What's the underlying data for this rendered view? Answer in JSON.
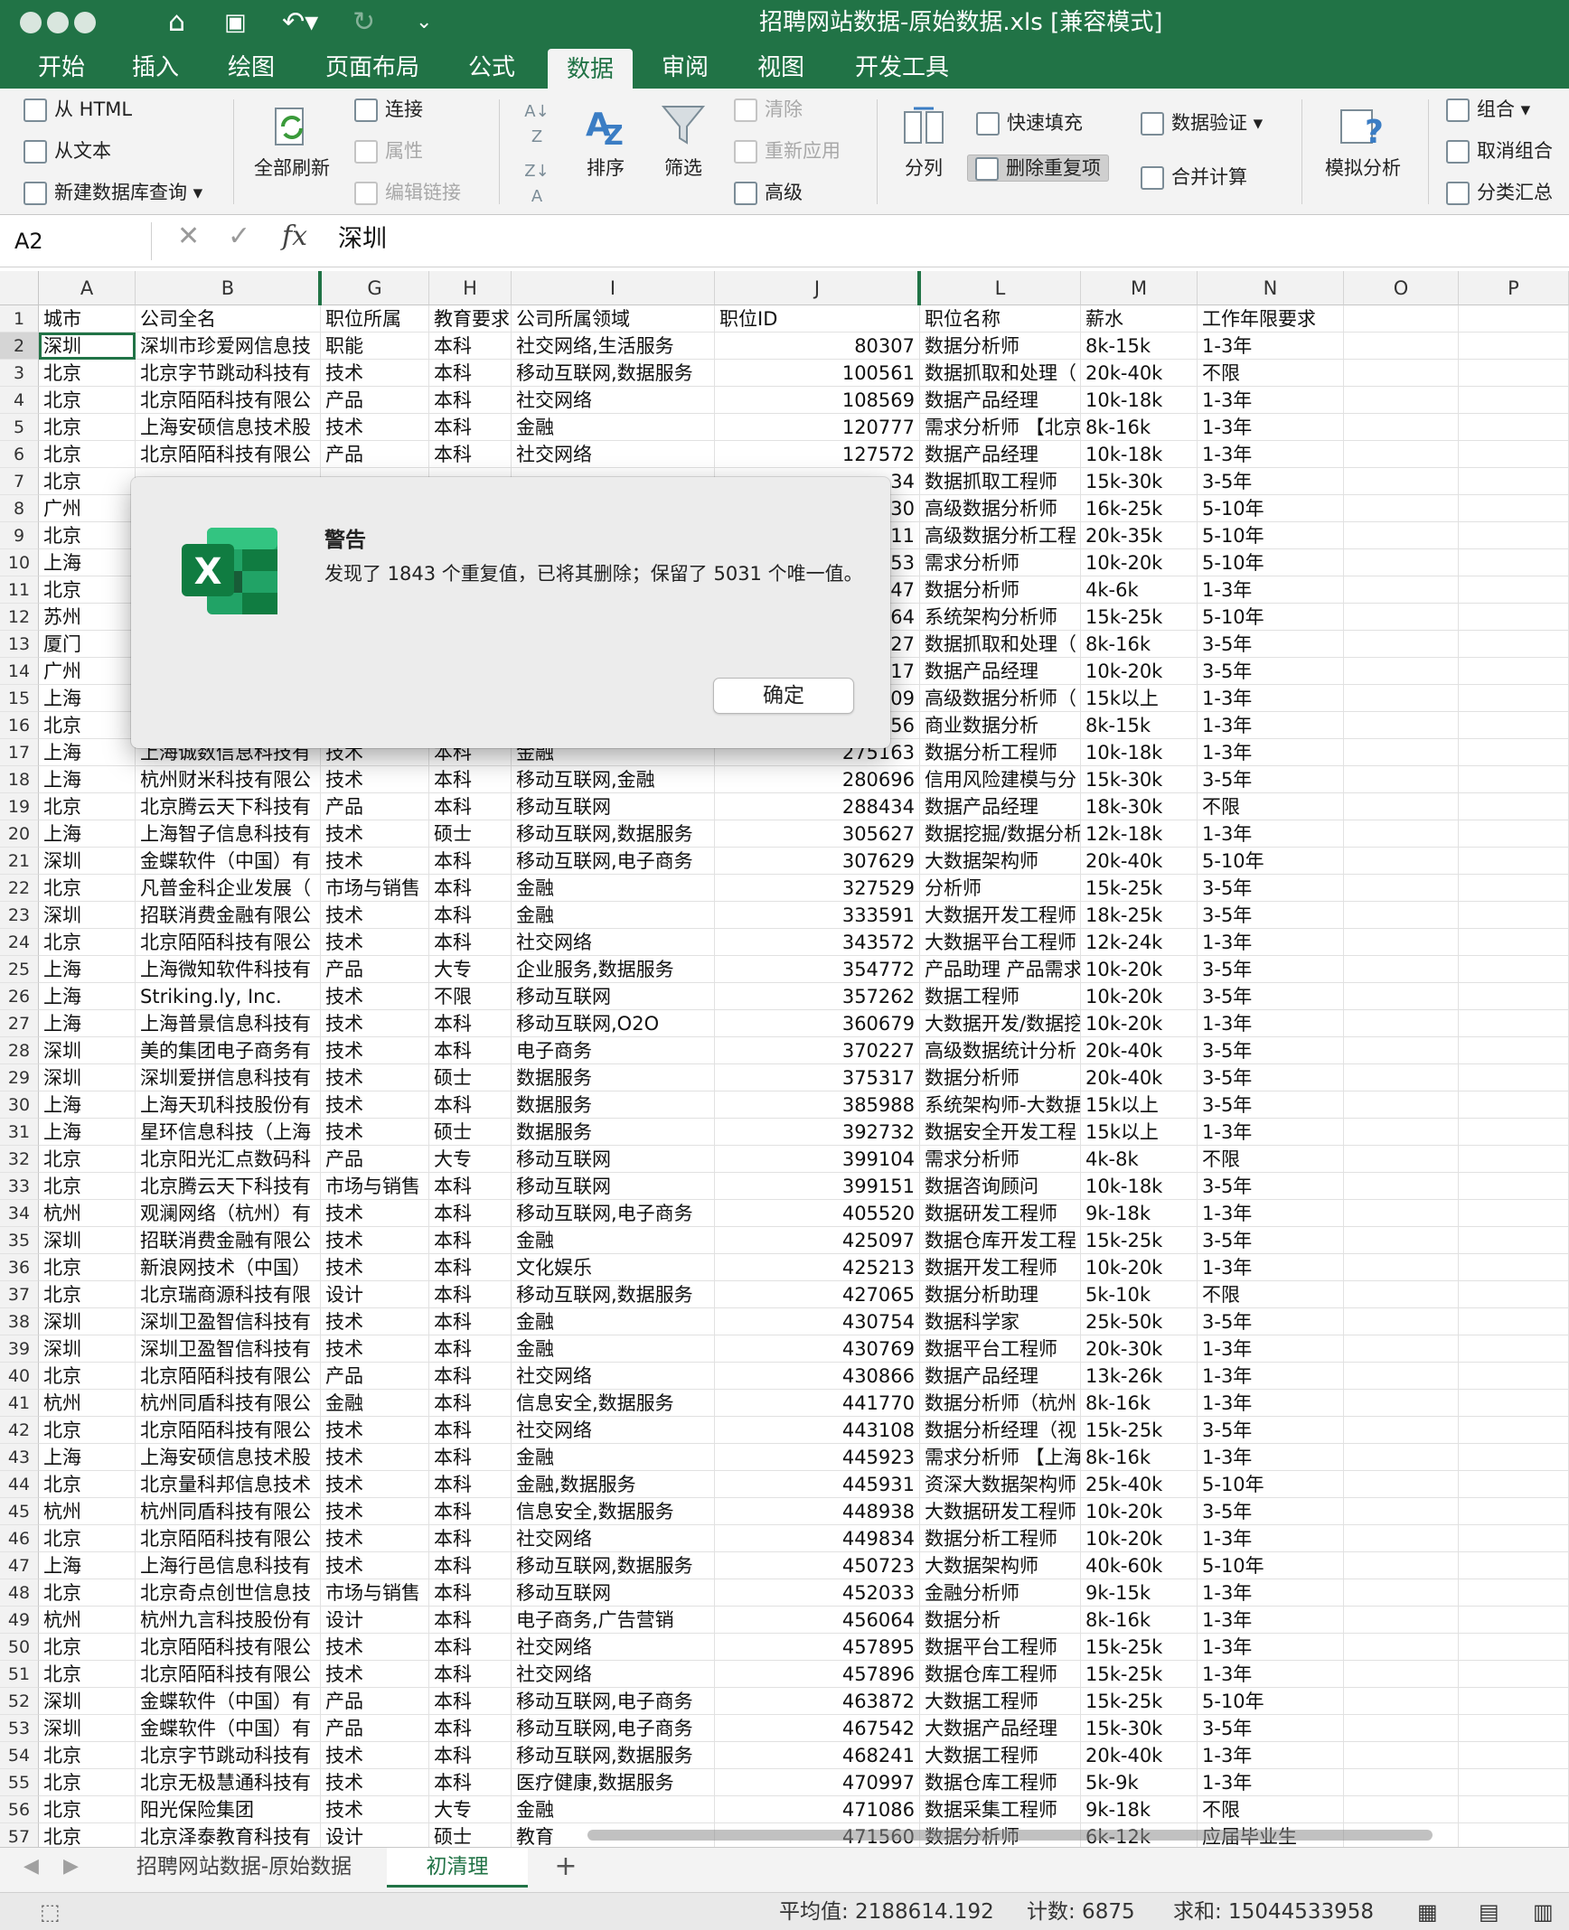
{
  "window": {
    "title": "招聘网站数据-原始数据.xls  [兼容模式]"
  },
  "ribbon_tabs": [
    {
      "label": "开始",
      "active": false
    },
    {
      "label": "插入",
      "active": false
    },
    {
      "label": "绘图",
      "active": false
    },
    {
      "label": "页面布局",
      "active": false
    },
    {
      "label": "公式",
      "active": false
    },
    {
      "label": "数据",
      "active": true
    },
    {
      "label": "审阅",
      "active": false
    },
    {
      "label": "视图",
      "active": false
    },
    {
      "label": "开发工具",
      "active": false
    }
  ],
  "ribbon": {
    "from_html": "从 HTML",
    "from_text": "从文本",
    "new_db_query": "新建数据库查询",
    "refresh_all": "全部刷新",
    "connections": "连接",
    "properties": "属性",
    "edit_links": "编辑链接",
    "sort": "排序",
    "filter": "筛选",
    "clear": "清除",
    "reapply": "重新应用",
    "advanced": "高级",
    "text_to_columns": "分列",
    "flash_fill": "快速填充",
    "remove_duplicates": "删除重复项",
    "data_validation": "数据验证",
    "consolidate": "合并计算",
    "what_if": "模拟分析",
    "group": "组合",
    "ungroup": "取消组合",
    "subtotal": "分类汇总"
  },
  "formula_bar": {
    "name_box": "A2",
    "fx": "fx",
    "value": "深圳"
  },
  "columns": [
    "A",
    "B",
    "G",
    "H",
    "I",
    "J",
    "L",
    "M",
    "N",
    "O",
    "P"
  ],
  "rows": [
    {
      "n": "1",
      "c": [
        "城市",
        "公司全名",
        "职位所属",
        "教育要求",
        "公司所属领域",
        "职位ID",
        "职位名称",
        "薪水",
        "工作年限要求"
      ]
    },
    {
      "n": "2",
      "c": [
        "深圳",
        "深圳市珍爱网信息技",
        "职能",
        "本科",
        "社交网络,生活服务",
        "80307",
        "数据分析师",
        "8k-15k",
        "1-3年"
      ]
    },
    {
      "n": "3",
      "c": [
        "北京",
        "北京字节跳动科技有",
        "技术",
        "本科",
        "移动互联网,数据服务",
        "100561",
        "数据抓取和处理（",
        "20k-40k",
        "不限"
      ]
    },
    {
      "n": "4",
      "c": [
        "北京",
        "北京陌陌科技有限公",
        "产品",
        "本科",
        "社交网络",
        "108569",
        "数据产品经理",
        "10k-18k",
        "1-3年"
      ]
    },
    {
      "n": "5",
      "c": [
        "北京",
        "上海安硕信息技术股",
        "技术",
        "本科",
        "金融",
        "120777",
        "需求分析师 【北京",
        "8k-16k",
        "1-3年"
      ]
    },
    {
      "n": "6",
      "c": [
        "北京",
        "北京陌陌科技有限公",
        "产品",
        "本科",
        "社交网络",
        "127572",
        "数据产品经理",
        "10k-18k",
        "1-3年"
      ]
    },
    {
      "n": "7",
      "c": [
        "北京",
        "",
        "",
        "",
        "",
        "34",
        "数据抓取工程师",
        "15k-30k",
        "3-5年"
      ]
    },
    {
      "n": "8",
      "c": [
        "广州",
        "",
        "",
        "",
        "",
        "30",
        "高级数据分析师",
        "16k-25k",
        "5-10年"
      ]
    },
    {
      "n": "9",
      "c": [
        "北京",
        "",
        "",
        "",
        "",
        "11",
        "高级数据分析工程",
        "20k-35k",
        "5-10年"
      ]
    },
    {
      "n": "10",
      "c": [
        "上海",
        "",
        "",
        "",
        "",
        "53",
        "需求分析师",
        "10k-20k",
        "5-10年"
      ]
    },
    {
      "n": "11",
      "c": [
        "北京",
        "",
        "",
        "",
        "",
        "47",
        "数据分析师",
        "4k-6k",
        "1-3年"
      ]
    },
    {
      "n": "12",
      "c": [
        "苏州",
        "",
        "",
        "",
        "",
        "64",
        "系统架构分析师",
        "15k-25k",
        "5-10年"
      ]
    },
    {
      "n": "13",
      "c": [
        "厦门",
        "",
        "",
        "",
        "",
        "27",
        "数据抓取和处理（",
        "8k-16k",
        "3-5年"
      ]
    },
    {
      "n": "14",
      "c": [
        "广州",
        "",
        "",
        "",
        "",
        "17",
        "数据产品经理",
        "10k-20k",
        "3-5年"
      ]
    },
    {
      "n": "15",
      "c": [
        "上海",
        "",
        "",
        "",
        "",
        "09",
        "高级数据分析师（",
        "15k以上",
        "1-3年"
      ]
    },
    {
      "n": "16",
      "c": [
        "北京",
        "",
        "",
        "",
        "",
        "56",
        "商业数据分析",
        "8k-15k",
        "1-3年"
      ]
    },
    {
      "n": "17",
      "c": [
        "上海",
        "上海诚数信息科技有",
        "技术",
        "本科",
        "金融",
        "275163",
        "数据分析工程师",
        "10k-18k",
        "1-3年"
      ]
    },
    {
      "n": "18",
      "c": [
        "上海",
        "杭州财米科技有限公",
        "技术",
        "本科",
        "移动互联网,金融",
        "280696",
        "信用风险建模与分",
        "15k-30k",
        "3-5年"
      ]
    },
    {
      "n": "19",
      "c": [
        "北京",
        "北京腾云天下科技有",
        "产品",
        "本科",
        "移动互联网",
        "288434",
        "数据产品经理",
        "18k-30k",
        "不限"
      ]
    },
    {
      "n": "20",
      "c": [
        "上海",
        "上海智子信息科技有",
        "技术",
        "硕士",
        "移动互联网,数据服务",
        "305627",
        "数据挖掘/数据分析",
        "12k-18k",
        "1-3年"
      ]
    },
    {
      "n": "21",
      "c": [
        "深圳",
        "金蝶软件（中国）有",
        "技术",
        "本科",
        "移动互联网,电子商务",
        "307629",
        "大数据架构师",
        "20k-40k",
        "5-10年"
      ]
    },
    {
      "n": "22",
      "c": [
        "北京",
        "凡普金科企业发展（",
        "市场与销售",
        "本科",
        "金融",
        "327529",
        "分析师",
        "15k-25k",
        "3-5年"
      ]
    },
    {
      "n": "23",
      "c": [
        "深圳",
        "招联消费金融有限公",
        "技术",
        "本科",
        "金融",
        "333591",
        "大数据开发工程师",
        "18k-25k",
        "3-5年"
      ]
    },
    {
      "n": "24",
      "c": [
        "北京",
        "北京陌陌科技有限公",
        "技术",
        "本科",
        "社交网络",
        "343572",
        "大数据平台工程师",
        "12k-24k",
        "1-3年"
      ]
    },
    {
      "n": "25",
      "c": [
        "上海",
        "上海微知软件科技有",
        "产品",
        "大专",
        "企业服务,数据服务",
        "354772",
        "产品助理 产品需求",
        "10k-20k",
        "3-5年"
      ]
    },
    {
      "n": "26",
      "c": [
        "上海",
        "Striking.ly, Inc.",
        "技术",
        "不限",
        "移动互联网",
        "357262",
        "数据工程师",
        "10k-20k",
        "3-5年"
      ]
    },
    {
      "n": "27",
      "c": [
        "上海",
        "上海普景信息科技有",
        "技术",
        "本科",
        "移动互联网,O2O",
        "360679",
        "大数据开发/数据挖",
        "10k-20k",
        "1-3年"
      ]
    },
    {
      "n": "28",
      "c": [
        "深圳",
        "美的集团电子商务有",
        "技术",
        "本科",
        "电子商务",
        "370227",
        "高级数据统计分析",
        "20k-40k",
        "3-5年"
      ]
    },
    {
      "n": "29",
      "c": [
        "深圳",
        "深圳爱拼信息科技有",
        "技术",
        "硕士",
        "数据服务",
        "375317",
        "数据分析师",
        "20k-40k",
        "3-5年"
      ]
    },
    {
      "n": "30",
      "c": [
        "上海",
        "上海天玑科技股份有",
        "技术",
        "本科",
        "数据服务",
        "385988",
        "系统架构师-大数据",
        "15k以上",
        "3-5年"
      ]
    },
    {
      "n": "31",
      "c": [
        "上海",
        "星环信息科技（上海",
        "技术",
        "硕士",
        "数据服务",
        "392732",
        "数据安全开发工程",
        "15k以上",
        "1-3年"
      ]
    },
    {
      "n": "32",
      "c": [
        "北京",
        "北京阳光汇点数码科",
        "产品",
        "大专",
        "移动互联网",
        "399104",
        "需求分析师",
        "4k-8k",
        "不限"
      ]
    },
    {
      "n": "33",
      "c": [
        "北京",
        "北京腾云天下科技有",
        "市场与销售",
        "本科",
        "移动互联网",
        "399151",
        "数据咨询顾问",
        "10k-18k",
        "3-5年"
      ]
    },
    {
      "n": "34",
      "c": [
        "杭州",
        "观澜网络（杭州）有",
        "技术",
        "本科",
        "移动互联网,电子商务",
        "405520",
        "数据研发工程师",
        "9k-18k",
        "1-3年"
      ]
    },
    {
      "n": "35",
      "c": [
        "深圳",
        "招联消费金融有限公",
        "技术",
        "本科",
        "金融",
        "425097",
        "数据仓库开发工程",
        "15k-25k",
        "3-5年"
      ]
    },
    {
      "n": "36",
      "c": [
        "北京",
        "新浪网技术（中国）",
        "技术",
        "本科",
        "文化娱乐",
        "425213",
        "数据开发工程师",
        "10k-20k",
        "1-3年"
      ]
    },
    {
      "n": "37",
      "c": [
        "北京",
        "北京瑞商源科技有限",
        "设计",
        "本科",
        "移动互联网,数据服务",
        "427065",
        "数据分析助理",
        "5k-10k",
        "不限"
      ]
    },
    {
      "n": "38",
      "c": [
        "深圳",
        "深圳卫盈智信科技有",
        "技术",
        "本科",
        "金融",
        "430754",
        "数据科学家",
        "25k-50k",
        "3-5年"
      ]
    },
    {
      "n": "39",
      "c": [
        "深圳",
        "深圳卫盈智信科技有",
        "技术",
        "本科",
        "金融",
        "430769",
        "数据平台工程师",
        "20k-30k",
        "1-3年"
      ]
    },
    {
      "n": "40",
      "c": [
        "北京",
        "北京陌陌科技有限公",
        "产品",
        "本科",
        "社交网络",
        "430866",
        "数据产品经理",
        "13k-26k",
        "1-3年"
      ]
    },
    {
      "n": "41",
      "c": [
        "杭州",
        "杭州同盾科技有限公",
        "金融",
        "本科",
        "信息安全,数据服务",
        "441770",
        "数据分析师（杭州",
        "8k-16k",
        "1-3年"
      ]
    },
    {
      "n": "42",
      "c": [
        "北京",
        "北京陌陌科技有限公",
        "技术",
        "本科",
        "社交网络",
        "443108",
        "数据分析经理（视",
        "15k-25k",
        "3-5年"
      ]
    },
    {
      "n": "43",
      "c": [
        "上海",
        "上海安硕信息技术股",
        "技术",
        "本科",
        "金融",
        "445923",
        "需求分析师 【上海",
        "8k-16k",
        "1-3年"
      ]
    },
    {
      "n": "44",
      "c": [
        "北京",
        "北京量科邦信息技术",
        "技术",
        "本科",
        "金融,数据服务",
        "445931",
        "资深大数据架构师",
        "25k-40k",
        "5-10年"
      ]
    },
    {
      "n": "45",
      "c": [
        "杭州",
        "杭州同盾科技有限公",
        "技术",
        "本科",
        "信息安全,数据服务",
        "448938",
        "大数据研发工程师",
        "10k-20k",
        "3-5年"
      ]
    },
    {
      "n": "46",
      "c": [
        "北京",
        "北京陌陌科技有限公",
        "技术",
        "本科",
        "社交网络",
        "449834",
        "数据分析工程师",
        "10k-20k",
        "1-3年"
      ]
    },
    {
      "n": "47",
      "c": [
        "上海",
        "上海行邑信息科技有",
        "技术",
        "本科",
        "移动互联网,数据服务",
        "450723",
        "大数据架构师",
        "40k-60k",
        "5-10年"
      ]
    },
    {
      "n": "48",
      "c": [
        "北京",
        "北京奇点创世信息技",
        "市场与销售",
        "本科",
        "移动互联网",
        "452033",
        "金融分析师",
        "9k-15k",
        "1-3年"
      ]
    },
    {
      "n": "49",
      "c": [
        "杭州",
        "杭州九言科技股份有",
        "设计",
        "本科",
        "电子商务,广告营销",
        "456064",
        "数据分析",
        "8k-16k",
        "1-3年"
      ]
    },
    {
      "n": "50",
      "c": [
        "北京",
        "北京陌陌科技有限公",
        "技术",
        "本科",
        "社交网络",
        "457895",
        "数据平台工程师",
        "15k-25k",
        "1-3年"
      ]
    },
    {
      "n": "51",
      "c": [
        "北京",
        "北京陌陌科技有限公",
        "技术",
        "本科",
        "社交网络",
        "457896",
        "数据仓库工程师",
        "15k-25k",
        "1-3年"
      ]
    },
    {
      "n": "52",
      "c": [
        "深圳",
        "金蝶软件（中国）有",
        "产品",
        "本科",
        "移动互联网,电子商务",
        "463872",
        "大数据工程师",
        "15k-25k",
        "5-10年"
      ]
    },
    {
      "n": "53",
      "c": [
        "深圳",
        "金蝶软件（中国）有",
        "产品",
        "本科",
        "移动互联网,电子商务",
        "467542",
        "大数据产品经理",
        "15k-30k",
        "3-5年"
      ]
    },
    {
      "n": "54",
      "c": [
        "北京",
        "北京字节跳动科技有",
        "技术",
        "本科",
        "移动互联网,数据服务",
        "468241",
        "大数据工程师",
        "20k-40k",
        "1-3年"
      ]
    },
    {
      "n": "55",
      "c": [
        "北京",
        "北京无极慧通科技有",
        "技术",
        "本科",
        "医疗健康,数据服务",
        "470997",
        "数据仓库工程师",
        "5k-9k",
        "1-3年"
      ]
    },
    {
      "n": "56",
      "c": [
        "北京",
        "阳光保险集团",
        "技术",
        "大专",
        "金融",
        "471086",
        "数据采集工程师",
        "9k-18k",
        "不限"
      ]
    },
    {
      "n": "57",
      "c": [
        "北京",
        "北京泽泰教育科技有",
        "设计",
        "硕士",
        "教育",
        "471560",
        "数据分析师",
        "6k-12k",
        "应届毕业生"
      ]
    }
  ],
  "dialog": {
    "title": "警告",
    "message": "发现了 1843 个重复值，已将其删除；保留了 5031 个唯一值。",
    "ok_label": "确定"
  },
  "sheet_tabs": [
    {
      "label": "招聘网站数据-原始数据",
      "active": false
    },
    {
      "label": "初清理",
      "active": true
    }
  ],
  "add_sheet": "+",
  "status": {
    "average": "平均值: 2188614.192",
    "count": "计数: 6875",
    "sum": "求和: 15044533958"
  },
  "colors": {
    "accent": "#217346",
    "ribbon_bg": "#f3f3f3",
    "dialog_bg": "#ececec"
  }
}
